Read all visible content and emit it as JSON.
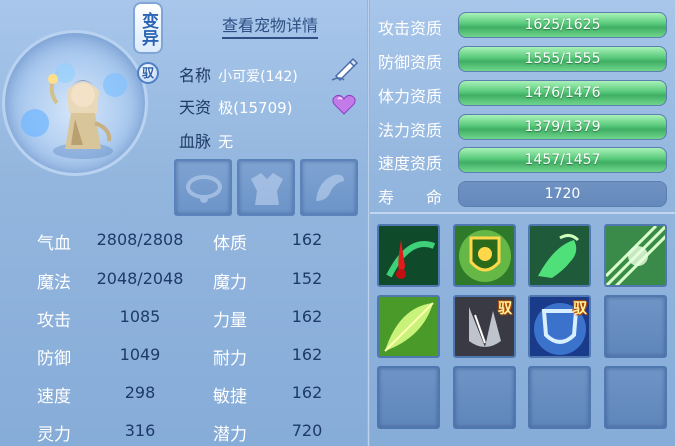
{
  "pet": {
    "variant_badge": "变异",
    "tame_badge": "驭",
    "view_detail": "查看宠物详情",
    "name_label": "名称",
    "name_value": "小可爱(142)",
    "talent_label": "天资",
    "talent_value": "极(15709)",
    "bloodline_label": "血脉",
    "bloodline_value": "无"
  },
  "stats": [
    {
      "label": "气血",
      "value": "2808/2808"
    },
    {
      "label": "魔法",
      "value": "2048/2048"
    },
    {
      "label": "攻击",
      "value": "1085"
    },
    {
      "label": "防御",
      "value": "1049"
    },
    {
      "label": "速度",
      "value": "298"
    },
    {
      "label": "灵力",
      "value": "316"
    }
  ],
  "attributes": [
    {
      "label": "体质",
      "value": "162"
    },
    {
      "label": "魔力",
      "value": "152"
    },
    {
      "label": "力量",
      "value": "162"
    },
    {
      "label": "耐力",
      "value": "162"
    },
    {
      "label": "敏捷",
      "value": "162"
    },
    {
      "label": "潜力",
      "value": "720"
    }
  ],
  "aptitudes": [
    {
      "label": "攻击资质",
      "value": "1625/1625",
      "current": 1625,
      "max": 1625
    },
    {
      "label": "防御资质",
      "value": "1555/1555",
      "current": 1555,
      "max": 1555
    },
    {
      "label": "体力资质",
      "value": "1476/1476",
      "current": 1476,
      "max": 1476
    },
    {
      "label": "法力资质",
      "value": "1379/1379",
      "current": 1379,
      "max": 1379
    },
    {
      "label": "速度资质",
      "value": "1457/1457",
      "current": 1457,
      "max": 1457
    }
  ],
  "life": {
    "label": "寿　　命",
    "value": "1720"
  },
  "skills": [
    {
      "icon": "blood-bleed-skill-icon",
      "tag": ""
    },
    {
      "icon": "green-shield-skill-icon",
      "tag": ""
    },
    {
      "icon": "green-beast-skill-icon",
      "tag": ""
    },
    {
      "icon": "green-burst-skill-icon",
      "tag": ""
    },
    {
      "icon": "green-leaf-skill-icon",
      "tag": ""
    },
    {
      "icon": "grey-claw-skill-icon",
      "tag": "驭"
    },
    {
      "icon": "blue-shield-skill-icon",
      "tag": "驭"
    },
    {
      "icon": "empty-skill-slot",
      "tag": ""
    },
    {
      "icon": "empty-skill-slot",
      "tag": ""
    },
    {
      "icon": "empty-skill-slot",
      "tag": ""
    },
    {
      "icon": "empty-skill-slot",
      "tag": ""
    },
    {
      "icon": "empty-skill-slot",
      "tag": ""
    }
  ],
  "colors": {
    "bar_fill": "#58c97a",
    "label_dark": "#1e3a66",
    "panel_bg": "#93b6de"
  }
}
